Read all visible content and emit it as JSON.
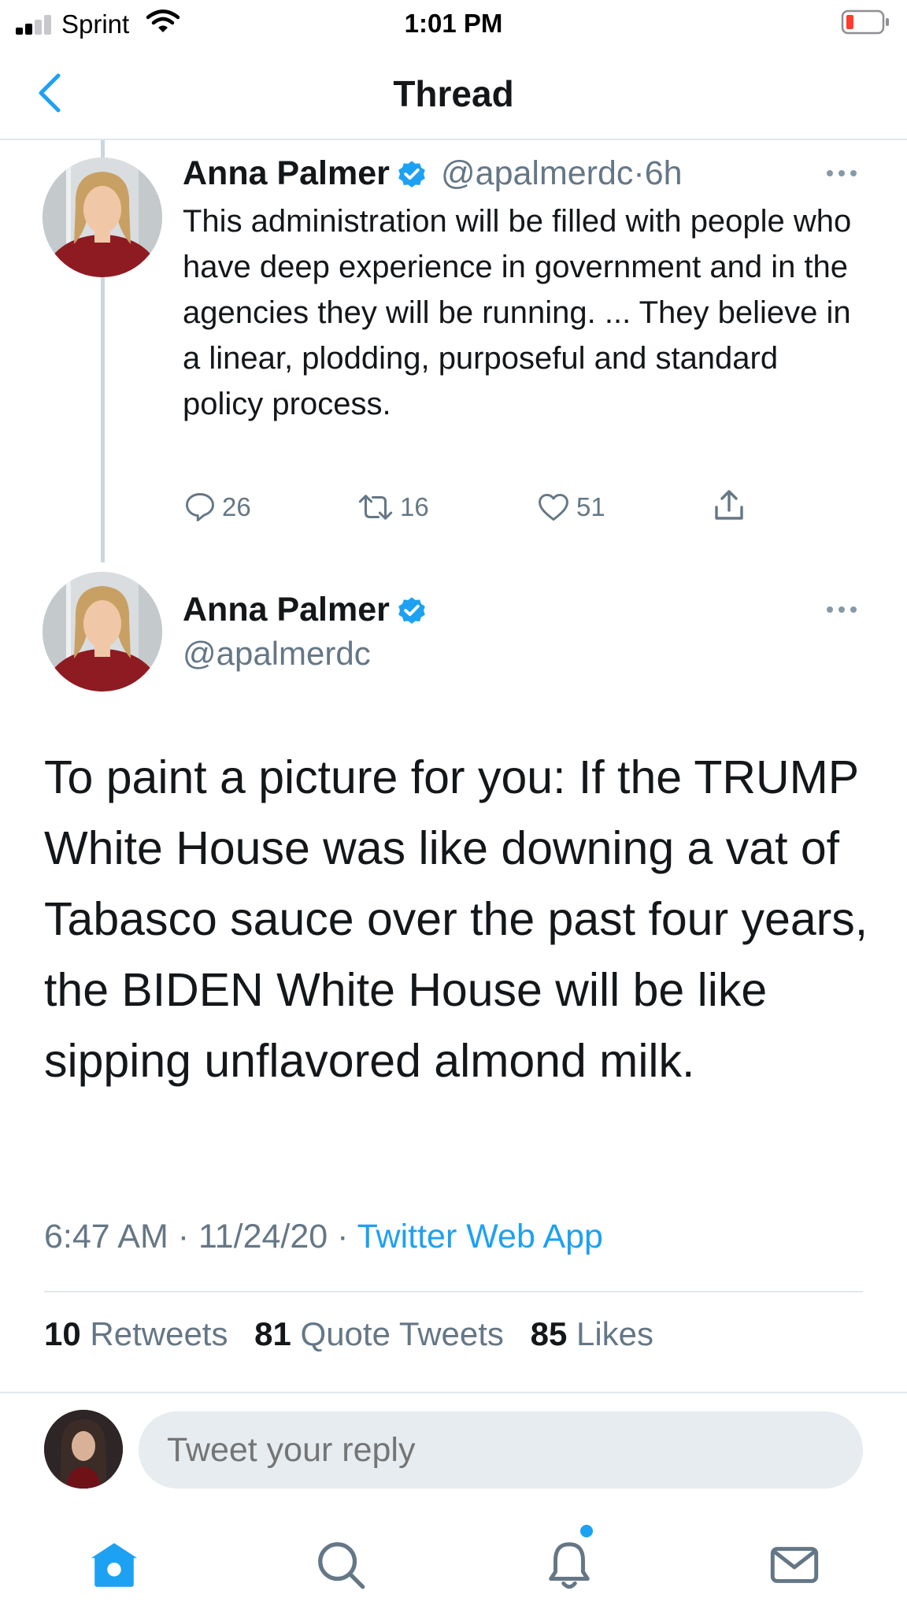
{
  "status_bar": {
    "carrier": "Sprint",
    "time": "1:01 PM"
  },
  "header": {
    "title": "Thread",
    "back_icon": "chevron-left-icon"
  },
  "parent_tweet": {
    "author_name": "Anna Palmer",
    "handle": "@apalmerdc",
    "separator": "·",
    "age": "6h",
    "text": "This administration will be filled with people who have deep experience in government and in the agencies they will be running. ... They believe in a linear, plodding, purposeful and standard policy process.",
    "replies": "26",
    "retweets": "16",
    "likes": "51"
  },
  "main_tweet": {
    "author_name": "Anna Palmer",
    "handle": "@apalmerdc",
    "text": "To paint a picture for you: If the TRUMP White House was like downing a vat of Tabasco sauce over the past four years, the BIDEN White House will be like sipping unflavored almond milk.",
    "time": "6:47 AM",
    "date": "11/24/20",
    "dot": "·",
    "source": "Twitter Web App",
    "retweets_count": "10",
    "retweets_label": "Retweets",
    "quotes_count": "81",
    "quotes_label": "Quote Tweets",
    "likes_count": "85",
    "likes_label": "Likes"
  },
  "reply": {
    "placeholder": "Tweet your reply"
  },
  "tabbar": {
    "items": [
      "home-icon",
      "search-icon",
      "bell-icon",
      "mail-icon"
    ]
  },
  "colors": {
    "accent": "#1da1f2",
    "text": "#14171a",
    "secondary": "#657786",
    "border": "#e1e8ed"
  }
}
